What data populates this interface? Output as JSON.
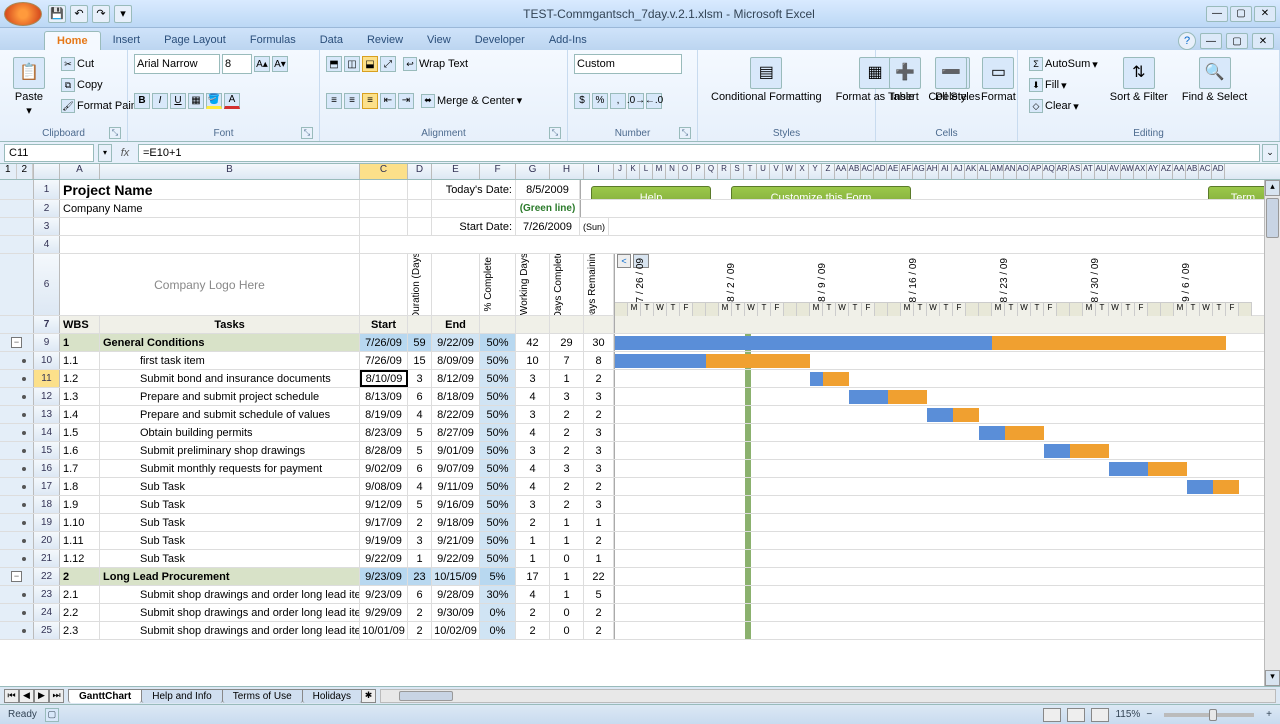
{
  "app": {
    "title": "TEST-Commgantsch_7day.v.2.1.xlsm - Microsoft Excel"
  },
  "ribbon": {
    "tabs": [
      "Home",
      "Insert",
      "Page Layout",
      "Formulas",
      "Data",
      "Review",
      "View",
      "Developer",
      "Add-Ins"
    ],
    "active_tab": "Home",
    "clipboard": {
      "paste": "Paste",
      "cut": "Cut",
      "copy": "Copy",
      "fmt_painter": "Format Painter",
      "label": "Clipboard"
    },
    "font": {
      "name": "Arial Narrow",
      "size": "8",
      "label": "Font"
    },
    "alignment": {
      "wrap": "Wrap Text",
      "merge": "Merge & Center",
      "label": "Alignment"
    },
    "number": {
      "format": "Custom",
      "label": "Number"
    },
    "styles": {
      "cond": "Conditional Formatting",
      "table": "Format as Table",
      "cell": "Cell Styles",
      "label": "Styles"
    },
    "cells": {
      "insert": "Insert",
      "delete": "Delete",
      "format": "Format",
      "label": "Cells"
    },
    "editing": {
      "autosum": "AutoSum",
      "fill": "Fill",
      "clear": "Clear",
      "sort": "Sort & Filter",
      "find": "Find & Select",
      "label": "Editing"
    }
  },
  "formula_bar": {
    "name_box": "C11",
    "formula": "=E10+1"
  },
  "columns": [
    "A",
    "B",
    "C",
    "D",
    "E",
    "F",
    "G",
    "H",
    "I",
    "J",
    "K",
    "L",
    "M",
    "N",
    "O",
    "P",
    "Q",
    "R",
    "S",
    "T",
    "U",
    "V",
    "W",
    "X",
    "Y",
    "Z"
  ],
  "header_block": {
    "project": "Project Name",
    "company": "Company Name",
    "logo": "Company Logo Here",
    "todays_date_lbl": "Today's Date:",
    "todays_date": "8/5/2009",
    "green_line": "(Green line)",
    "start_date_lbl": "Start Date:",
    "start_date": "7/26/2009",
    "start_dow": "(Sun)",
    "help_btn": "Help",
    "customize_btn": "Customize this Form",
    "term_btn": "Term"
  },
  "col_hdrs": {
    "wbs": "WBS",
    "tasks": "Tasks",
    "start": "Start",
    "duration": "Duration (Days)",
    "end": "End",
    "pct": "% Complete",
    "working": "Working Days",
    "days_complete": "Days Complete",
    "days_remaining": "Days Remaining"
  },
  "gantt_weeks": [
    "7 / 26 / 09",
    "8 / 2 / 09",
    "8 / 9 / 09",
    "8 / 16 / 09",
    "8 / 23 / 09",
    "8 / 30 / 09",
    "9 / 6 / 09"
  ],
  "gantt_day_letters": [
    "M",
    "T",
    "W",
    "T",
    "F"
  ],
  "rows": [
    {
      "n": 9,
      "wbs": "1",
      "task": "General Conditions",
      "start": "7/26/09",
      "dur": "59",
      "end": "9/22/09",
      "pct": "50%",
      "wd": "42",
      "dc": "29",
      "dr": "30",
      "section": true,
      "g": {
        "a": 0,
        "b": 29,
        "c": 47
      }
    },
    {
      "n": 10,
      "wbs": "1.1",
      "task": "first task item",
      "start": "7/26/09",
      "dur": "15",
      "end": "8/09/09",
      "pct": "50%",
      "wd": "10",
      "dc": "7",
      "dr": "8",
      "g": {
        "a": 0,
        "b": 7,
        "c": 15
      }
    },
    {
      "n": 11,
      "wbs": "1.2",
      "task": "Submit bond and insurance documents",
      "start": "8/10/09",
      "dur": "3",
      "end": "8/12/09",
      "pct": "50%",
      "wd": "3",
      "dc": "1",
      "dr": "2",
      "sel": true,
      "g": {
        "a": 15,
        "b": 16,
        "c": 18
      }
    },
    {
      "n": 12,
      "wbs": "1.3",
      "task": "Prepare and submit project schedule",
      "start": "8/13/09",
      "dur": "6",
      "end": "8/18/09",
      "pct": "50%",
      "wd": "4",
      "dc": "3",
      "dr": "3",
      "g": {
        "a": 18,
        "b": 21,
        "c": 24
      }
    },
    {
      "n": 13,
      "wbs": "1.4",
      "task": "Prepare and submit schedule of values",
      "start": "8/19/09",
      "dur": "4",
      "end": "8/22/09",
      "pct": "50%",
      "wd": "3",
      "dc": "2",
      "dr": "2",
      "g": {
        "a": 24,
        "b": 26,
        "c": 28
      }
    },
    {
      "n": 14,
      "wbs": "1.5",
      "task": "Obtain building permits",
      "start": "8/23/09",
      "dur": "5",
      "end": "8/27/09",
      "pct": "50%",
      "wd": "4",
      "dc": "2",
      "dr": "3",
      "g": {
        "a": 28,
        "b": 30,
        "c": 33
      }
    },
    {
      "n": 15,
      "wbs": "1.6",
      "task": "Submit preliminary shop drawings",
      "start": "8/28/09",
      "dur": "5",
      "end": "9/01/09",
      "pct": "50%",
      "wd": "3",
      "dc": "2",
      "dr": "3",
      "g": {
        "a": 33,
        "b": 35,
        "c": 38
      }
    },
    {
      "n": 16,
      "wbs": "1.7",
      "task": "Submit monthly requests for payment",
      "start": "9/02/09",
      "dur": "6",
      "end": "9/07/09",
      "pct": "50%",
      "wd": "4",
      "dc": "3",
      "dr": "3",
      "g": {
        "a": 38,
        "b": 41,
        "c": 44
      }
    },
    {
      "n": 17,
      "wbs": "1.8",
      "task": "Sub Task",
      "start": "9/08/09",
      "dur": "4",
      "end": "9/11/09",
      "pct": "50%",
      "wd": "4",
      "dc": "2",
      "dr": "2",
      "g": {
        "a": 44,
        "b": 46,
        "c": 48
      }
    },
    {
      "n": 18,
      "wbs": "1.9",
      "task": "Sub Task",
      "start": "9/12/09",
      "dur": "5",
      "end": "9/16/09",
      "pct": "50%",
      "wd": "3",
      "dc": "2",
      "dr": "3"
    },
    {
      "n": 19,
      "wbs": "1.10",
      "task": "Sub Task",
      "start": "9/17/09",
      "dur": "2",
      "end": "9/18/09",
      "pct": "50%",
      "wd": "2",
      "dc": "1",
      "dr": "1"
    },
    {
      "n": 20,
      "wbs": "1.11",
      "task": "Sub Task",
      "start": "9/19/09",
      "dur": "3",
      "end": "9/21/09",
      "pct": "50%",
      "wd": "1",
      "dc": "1",
      "dr": "2"
    },
    {
      "n": 21,
      "wbs": "1.12",
      "task": "Sub Task",
      "start": "9/22/09",
      "dur": "1",
      "end": "9/22/09",
      "pct": "50%",
      "wd": "1",
      "dc": "0",
      "dr": "1"
    },
    {
      "n": 22,
      "wbs": "2",
      "task": "Long Lead Procurement",
      "start": "9/23/09",
      "dur": "23",
      "end": "10/15/09",
      "pct": "5%",
      "wd": "17",
      "dc": "1",
      "dr": "22",
      "section": true
    },
    {
      "n": 23,
      "wbs": "2.1",
      "task": "Submit shop drawings and order long lead items - steel",
      "start": "9/23/09",
      "dur": "6",
      "end": "9/28/09",
      "pct": "30%",
      "wd": "4",
      "dc": "1",
      "dr": "5"
    },
    {
      "n": 24,
      "wbs": "2.2",
      "task": "Submit shop drawings and order long lead items - roofing",
      "start": "9/29/09",
      "dur": "2",
      "end": "9/30/09",
      "pct": "0%",
      "wd": "2",
      "dc": "0",
      "dr": "2"
    },
    {
      "n": 25,
      "wbs": "2.3",
      "task": "Submit shop drawings and order long lead items - elevator",
      "start": "10/01/09",
      "dur": "2",
      "end": "10/02/09",
      "pct": "0%",
      "wd": "2",
      "dc": "0",
      "dr": "2"
    }
  ],
  "sheets": [
    "GanttChart",
    "Help and Info",
    "Terms of Use",
    "Holidays"
  ],
  "status": {
    "ready": "Ready",
    "zoom": "115%"
  }
}
